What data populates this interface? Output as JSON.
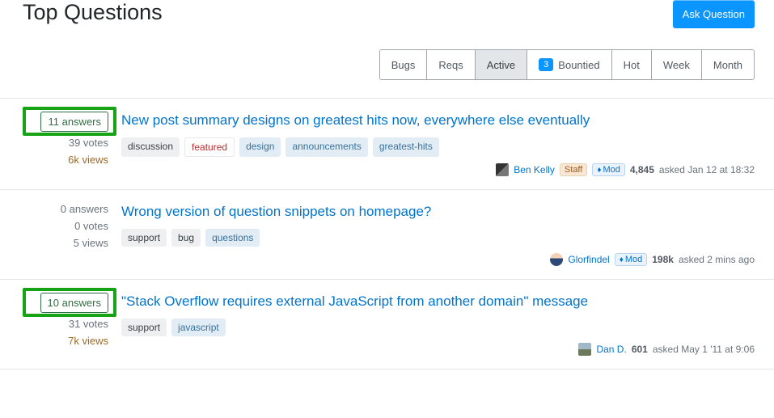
{
  "header": {
    "title": "Top Questions",
    "ask_button": "Ask Question"
  },
  "tabs": {
    "items": [
      {
        "label": "Bugs"
      },
      {
        "label": "Reqs"
      },
      {
        "label": "Active"
      },
      {
        "label": "Bountied",
        "badge": "3"
      },
      {
        "label": "Hot"
      },
      {
        "label": "Week"
      },
      {
        "label": "Month"
      }
    ],
    "active_index": 2
  },
  "questions": [
    {
      "answers": "11 answers",
      "votes": "39 votes",
      "views": "6k views",
      "views_hot": true,
      "highlight": true,
      "title": "New post summary designs on greatest hits now, everywhere else eventually",
      "tags": [
        {
          "label": "discussion",
          "style": "plain"
        },
        {
          "label": "featured",
          "style": "featured"
        },
        {
          "label": "design",
          "style": "blue"
        },
        {
          "label": "announcements",
          "style": "blue"
        },
        {
          "label": "greatest-hits",
          "style": "blue"
        }
      ],
      "user": {
        "name": "Ben Kelly",
        "rep": "4,845",
        "staff": true,
        "mod": true,
        "avatar": "av1"
      },
      "time": "asked Jan 12 at 18:32"
    },
    {
      "answers": "0 answers",
      "votes": "0 votes",
      "views": "5 views",
      "views_hot": false,
      "highlight": false,
      "title": "Wrong version of question snippets on homepage?",
      "tags": [
        {
          "label": "support",
          "style": "plain"
        },
        {
          "label": "bug",
          "style": "plain"
        },
        {
          "label": "questions",
          "style": "blue"
        }
      ],
      "user": {
        "name": "Glorfindel",
        "rep": "198k",
        "staff": false,
        "mod": true,
        "avatar": "av2"
      },
      "time": "asked 2 mins ago"
    },
    {
      "answers": "10 answers",
      "votes": "31 votes",
      "views": "7k views",
      "views_hot": true,
      "highlight": true,
      "title": "\"Stack Overflow requires external JavaScript from another domain\" message",
      "tags": [
        {
          "label": "support",
          "style": "plain"
        },
        {
          "label": "javascript",
          "style": "blue"
        }
      ],
      "user": {
        "name": "Dan D.",
        "rep": "601",
        "staff": false,
        "mod": false,
        "avatar": "av3"
      },
      "time": "asked May 1 '11 at 9:06"
    }
  ],
  "labels": {
    "staff": "Staff",
    "mod": "Mod"
  }
}
